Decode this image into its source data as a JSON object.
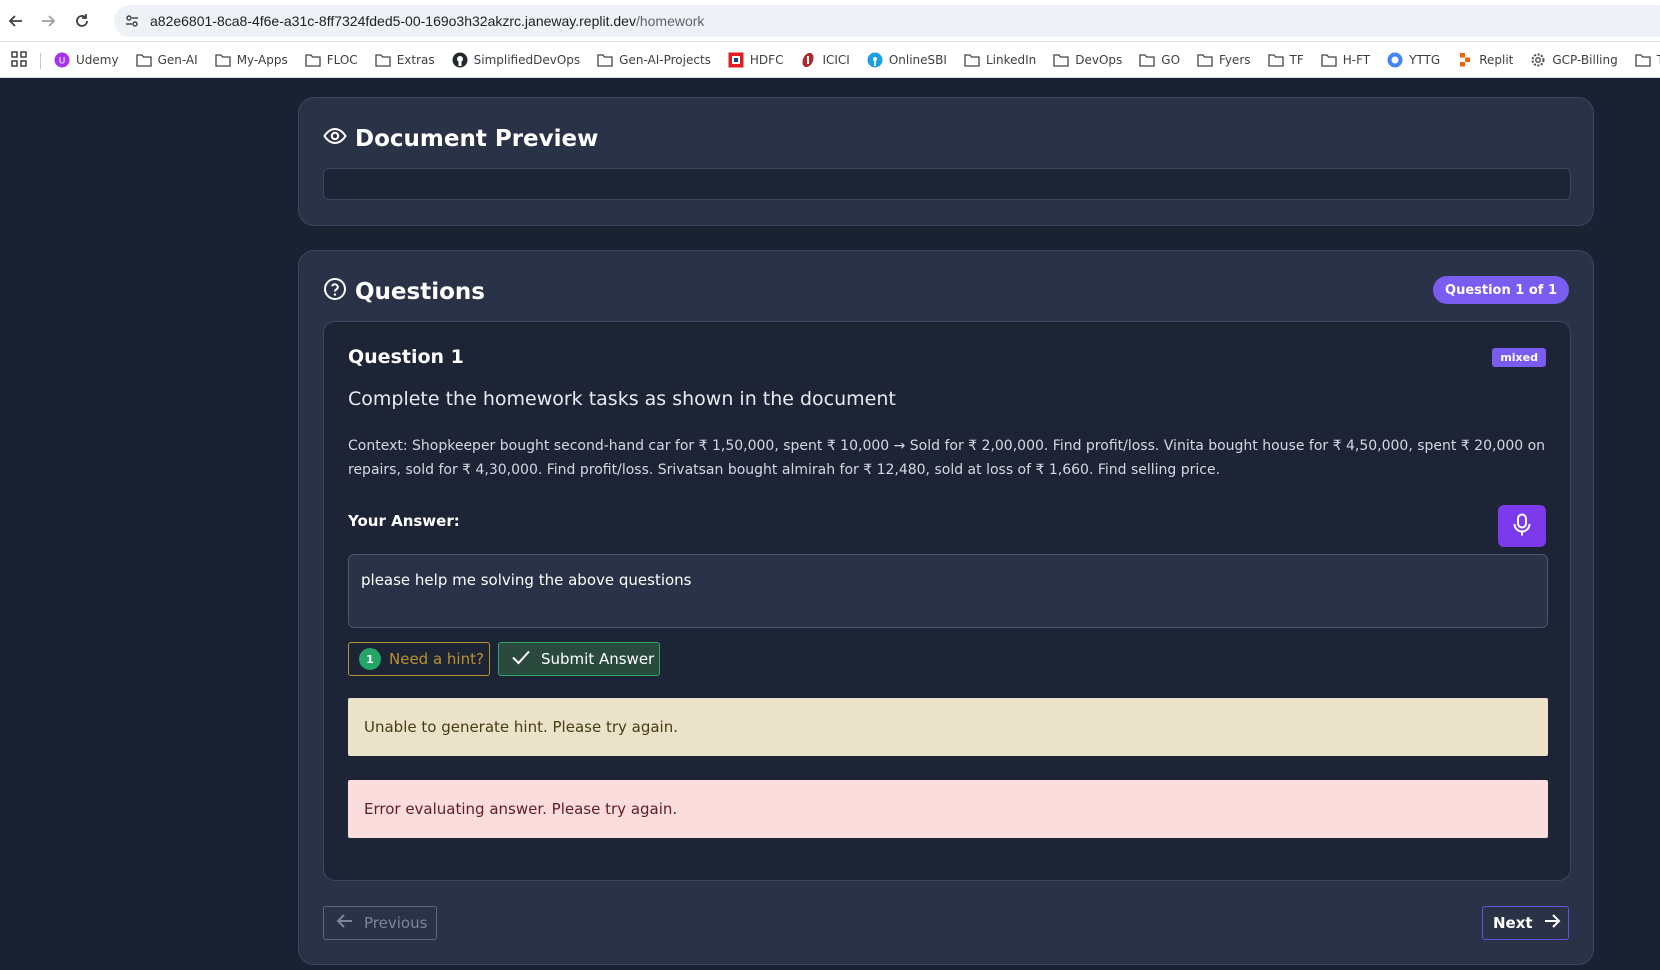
{
  "browser": {
    "url_host": "a82e6801-8ca8-4f6e-a31c-8ff7324fded5-00-169o3h32akzrc.janeway.replit.dev",
    "url_path": "/homework",
    "bookmarks": [
      {
        "label": "Udemy",
        "icon": "udemy-icon"
      },
      {
        "label": "Gen-AI",
        "icon": "folder-icon"
      },
      {
        "label": "My-Apps",
        "icon": "folder-icon"
      },
      {
        "label": "FLOC",
        "icon": "folder-icon"
      },
      {
        "label": "Extras",
        "icon": "folder-icon"
      },
      {
        "label": "SimplifiedDevOps",
        "icon": "github-icon"
      },
      {
        "label": "Gen-AI-Projects",
        "icon": "folder-icon"
      },
      {
        "label": "HDFC",
        "icon": "hdfc-icon"
      },
      {
        "label": "ICICI",
        "icon": "icici-icon"
      },
      {
        "label": "OnlineSBI",
        "icon": "sbi-icon"
      },
      {
        "label": "LinkedIn",
        "icon": "folder-icon"
      },
      {
        "label": "DevOps",
        "icon": "folder-icon"
      },
      {
        "label": "GO",
        "icon": "folder-icon"
      },
      {
        "label": "Fyers",
        "icon": "folder-icon"
      },
      {
        "label": "TF",
        "icon": "folder-icon"
      },
      {
        "label": "H-FT",
        "icon": "folder-icon"
      },
      {
        "label": "YTTG",
        "icon": "yttg-icon"
      },
      {
        "label": "Replit",
        "icon": "replit-icon"
      },
      {
        "label": "GCP-Billing",
        "icon": "gear-icon"
      },
      {
        "label": "Tirumala",
        "icon": "folder-icon"
      }
    ]
  },
  "preview": {
    "title": "Document Preview"
  },
  "questions": {
    "title": "Questions",
    "counter": "Question 1 of 1",
    "heading": "Question 1",
    "type_badge": "mixed",
    "prompt": "Complete the homework tasks as shown in the document",
    "context": "Context: Shopkeeper bought second-hand car for ₹ 1,50,000, spent ₹ 10,000 → Sold for ₹ 2,00,000. Find profit/loss. Vinita bought house for ₹ 4,50,000, spent ₹ 20,000 on repairs, sold for ₹ 4,30,000. Find profit/loss. Srivatsan bought almirah for ₹ 12,480, sold at loss of ₹ 1,660. Find selling price.",
    "answer_label": "Your Answer:",
    "answer_value": "please help me solving the above questions",
    "hint_count": "1",
    "hint_label": "Need a hint?",
    "submit_label": "Submit Answer",
    "hint_message": "Unable to generate hint. Please try again.",
    "error_message": "Error evaluating answer. Please try again.",
    "prev_label": "Previous",
    "next_label": "Next"
  },
  "colors": {
    "page_bg": "#1a2133",
    "card_bg": "#2a3247",
    "accent_purple": "#7b5cf0",
    "hint_amber": "#b8922c",
    "submit_green": "#2fa86a"
  }
}
